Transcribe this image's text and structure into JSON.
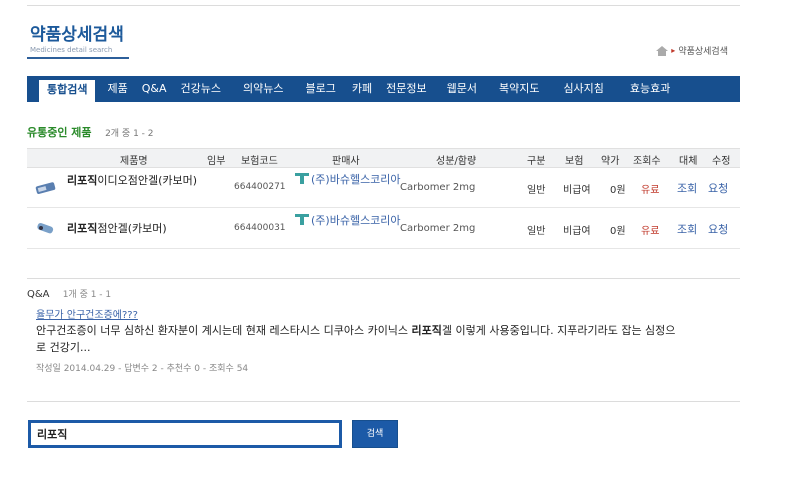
{
  "header": {
    "title": "약품상세검색",
    "subtitle": "Medicines detail search",
    "breadcrumb": "약품상세검색"
  },
  "nav": {
    "items": [
      {
        "label": "통합검색",
        "active": true
      },
      {
        "label": "제품"
      },
      {
        "label": "Q&A"
      },
      {
        "label": "건강뉴스"
      },
      {
        "label": "의약뉴스"
      },
      {
        "label": "블로그"
      },
      {
        "label": "카페"
      },
      {
        "label": "전문정보"
      },
      {
        "label": "웹문서"
      },
      {
        "label": "복약지도"
      },
      {
        "label": "심사지침"
      },
      {
        "label": "효능효과"
      }
    ]
  },
  "products": {
    "title": "유통중인 제품",
    "count": "2개 중 1 - 2",
    "columns": [
      "제품명",
      "임부",
      "보험코드",
      "판매사",
      "성분/함량",
      "구분",
      "보험",
      "약가",
      "조회수",
      "대체",
      "수정"
    ],
    "rows": [
      {
        "name_bold": "리포직",
        "name_rest": "이디오점안겔(카보머)",
        "pregnancy": "",
        "code": "664400271",
        "seller": "(주)바슈헬스코리아",
        "ingredient": "Carbomer 2mg",
        "type": "일반",
        "insurance": "비급여",
        "price": "0원",
        "views": "유료",
        "substitute": "조회",
        "edit": "요청"
      },
      {
        "name_bold": "리포직",
        "name_rest": "점안겔(카보머)",
        "pregnancy": "",
        "code": "664400031",
        "seller": "(주)바슈헬스코리아",
        "ingredient": "Carbomer 2mg",
        "type": "일반",
        "insurance": "비급여",
        "price": "0원",
        "views": "유료",
        "substitute": "조회",
        "edit": "요청"
      }
    ]
  },
  "qa": {
    "label": "Q&A",
    "count": "1개 중 1 - 1",
    "item": {
      "title": "율무가 안구건조증에???",
      "body_before": "안구건조증이 너무 심하신 환자분이 계시는데 현재 레스타시스 디쿠아스 카이닉스 ",
      "body_bold": "리포직",
      "body_after": "겔 이렇게 사용중입니다. 지푸라기라도 잡는 심정으로 건강기...",
      "meta": "작성일 2014.04.29 - 답변수 2 - 추천수 0 - 조회수 54"
    }
  },
  "search": {
    "value": "리포직",
    "button": "검색"
  },
  "colors": {
    "nav_bg": "#174f8e",
    "accent_green": "#2a8a2a",
    "link_blue": "#3a63a8",
    "red": "#c0392b"
  }
}
